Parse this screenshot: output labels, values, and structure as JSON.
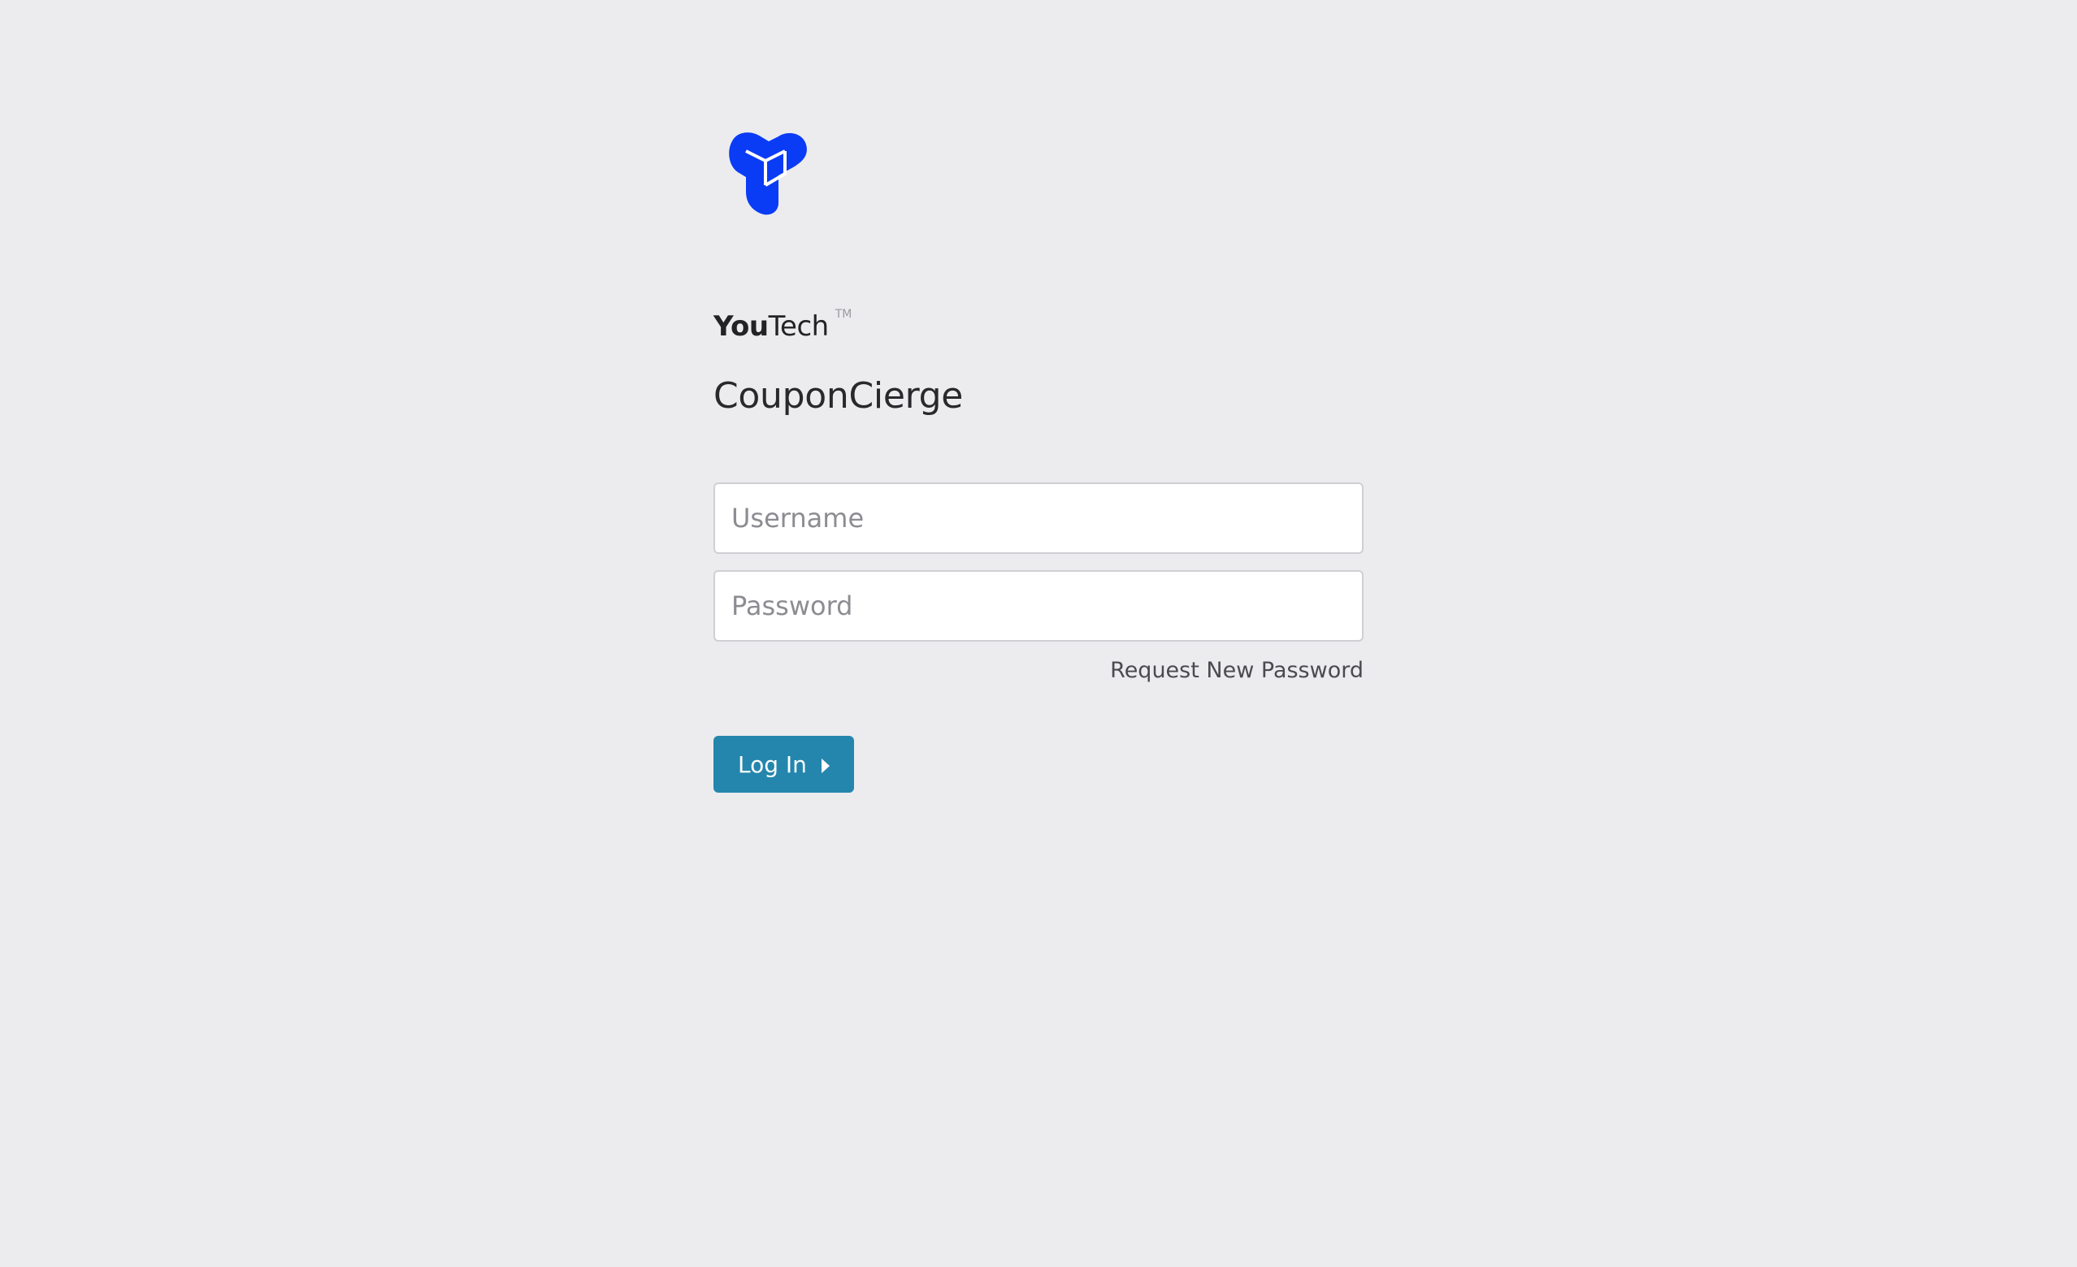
{
  "brand": {
    "logo_icon": "youtech-knot-logo-icon",
    "wordmark_bold": "You",
    "wordmark_light": "Tech",
    "trademark": "TM",
    "logo_color": "#0a3cf5"
  },
  "app": {
    "title": "CouponCierge"
  },
  "form": {
    "username_placeholder": "Username",
    "username_value": "",
    "password_placeholder": "Password",
    "password_value": "",
    "forgot_link": "Request New Password",
    "login_label": "Log In",
    "login_icon": "caret-right-icon",
    "button_color": "#2586ad"
  },
  "theme": {
    "background": "#ececef"
  }
}
